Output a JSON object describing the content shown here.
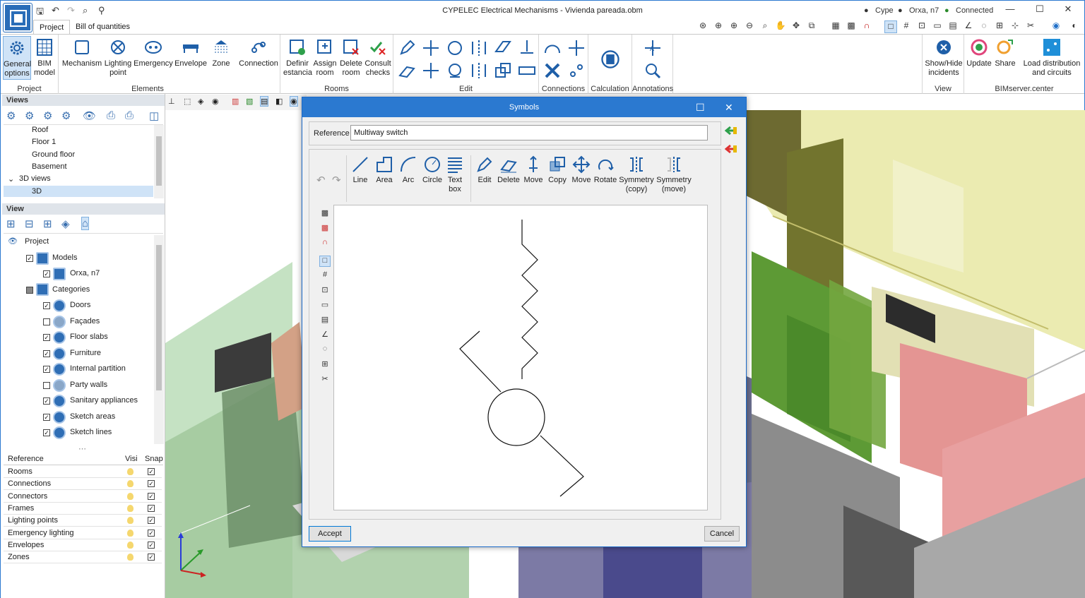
{
  "window": {
    "title": "CYPELEC Electrical Mechanisms - Vivienda pareada.obm",
    "status": {
      "user": "Cype",
      "server": "Orxa, n7",
      "connection": "Connected"
    }
  },
  "tabs": [
    "Project",
    "Bill of quantities"
  ],
  "ribbon": {
    "project": {
      "label": "Project",
      "buttons": [
        "General options",
        "BIM model"
      ]
    },
    "elements": {
      "label": "Elements",
      "buttons": [
        "Mechanism",
        "Lighting point",
        "Emergency",
        "Envelope",
        "Zone"
      ]
    },
    "connection": {
      "buttons": [
        "Connection"
      ]
    },
    "rooms": {
      "label": "Rooms",
      "buttons": [
        "Definir estancia",
        "Assign room",
        "Delete room",
        "Consult checks"
      ]
    },
    "edit": {
      "label": "Edit"
    },
    "connections": {
      "label": "Connections"
    },
    "calculation": {
      "label": "Calculation"
    },
    "annotations": {
      "label": "Annotations"
    },
    "view": {
      "label": "View",
      "buttons": [
        "Show/Hide incidents"
      ]
    },
    "bimserver": {
      "label": "BIMserver.center",
      "buttons": [
        "Update",
        "Share",
        "Load distribution and circuits"
      ]
    }
  },
  "views_panel": {
    "title": "Views",
    "items": [
      "Roof",
      "Floor 1",
      "Ground floor",
      "Basement",
      "3D views",
      "3D"
    ]
  },
  "view_panel": {
    "title": "View",
    "tree": {
      "project": "Project",
      "models": "Models",
      "model_item": "Orxa, n7",
      "categories": "Categories",
      "items": [
        {
          "label": "Doors",
          "checked": true
        },
        {
          "label": "Façades",
          "checked": false
        },
        {
          "label": "Floor slabs",
          "checked": true
        },
        {
          "label": "Furniture",
          "checked": true
        },
        {
          "label": "Internal partition",
          "checked": true
        },
        {
          "label": "Party walls",
          "checked": false
        },
        {
          "label": "Sanitary appliances",
          "checked": true
        },
        {
          "label": "Sketch areas",
          "checked": true
        },
        {
          "label": "Sketch lines",
          "checked": true
        }
      ]
    }
  },
  "reference_table": {
    "headers": [
      "Reference",
      "Visi",
      "Snap"
    ],
    "rows": [
      "Rooms",
      "Connections",
      "Connectors",
      "Frames",
      "Lighting points",
      "Emergency lighting",
      "Envelopes",
      "Zones"
    ]
  },
  "dialog": {
    "title": "Symbols",
    "reference_label": "Reference",
    "reference_value": "Multiway switch",
    "tools": [
      "Line",
      "Area",
      "Arc",
      "Circle",
      "Text box",
      "Edit",
      "Delete",
      "Move",
      "Copy",
      "Move",
      "Rotate",
      "Symmetry (copy)",
      "Symmetry (move)"
    ],
    "accept": "Accept",
    "cancel": "Cancel"
  },
  "colors": {
    "accent": "#2b79d0",
    "selection": "#cfe3f7",
    "icon_blue": "#2f6eb5"
  }
}
